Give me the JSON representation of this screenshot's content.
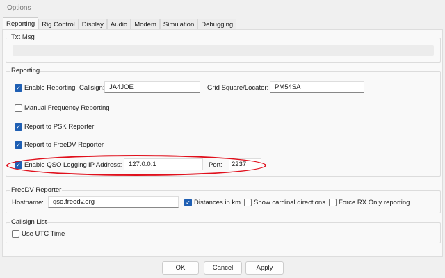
{
  "window": {
    "title": "Options"
  },
  "tabs": [
    "Reporting",
    "Rig Control",
    "Display",
    "Audio",
    "Modem",
    "Simulation",
    "Debugging"
  ],
  "txt_msg": {
    "label": "Txt Msg",
    "value": ""
  },
  "reporting": {
    "label": "Reporting",
    "enable_reporting": {
      "label": "Enable Reporting",
      "checked": true
    },
    "callsign_label": "Callsign:",
    "callsign": "JA4JOE",
    "grid_label": "Grid Square/Locator:",
    "grid": "PM54SA",
    "manual_freq": {
      "label": "Manual Frequency Reporting",
      "checked": false
    },
    "psk": {
      "label": "Report to PSK Reporter",
      "checked": true
    },
    "freedv": {
      "label": "Report to FreeDV Reporter",
      "checked": true
    },
    "qso": {
      "label": "Enable QSO Logging",
      "checked": true
    },
    "ip_label": "IP Address:",
    "ip": "127.0.0.1",
    "port_label": "Port:",
    "port": "2237",
    "highlight_color": "#e0101c"
  },
  "freedv_reporter": {
    "label": "FreeDV Reporter",
    "hostname_label": "Hostname:",
    "hostname": "qso.freedv.org",
    "distances": {
      "label": "Distances in km",
      "checked": true
    },
    "cardinal": {
      "label": "Show cardinal directions",
      "checked": false
    },
    "force_rx": {
      "label": "Force RX Only reporting",
      "checked": false
    }
  },
  "callsign_list": {
    "label": "Callsign List",
    "utc": {
      "label": "Use UTC Time",
      "checked": false
    }
  },
  "buttons": {
    "ok": "OK",
    "cancel": "Cancel",
    "apply": "Apply"
  }
}
